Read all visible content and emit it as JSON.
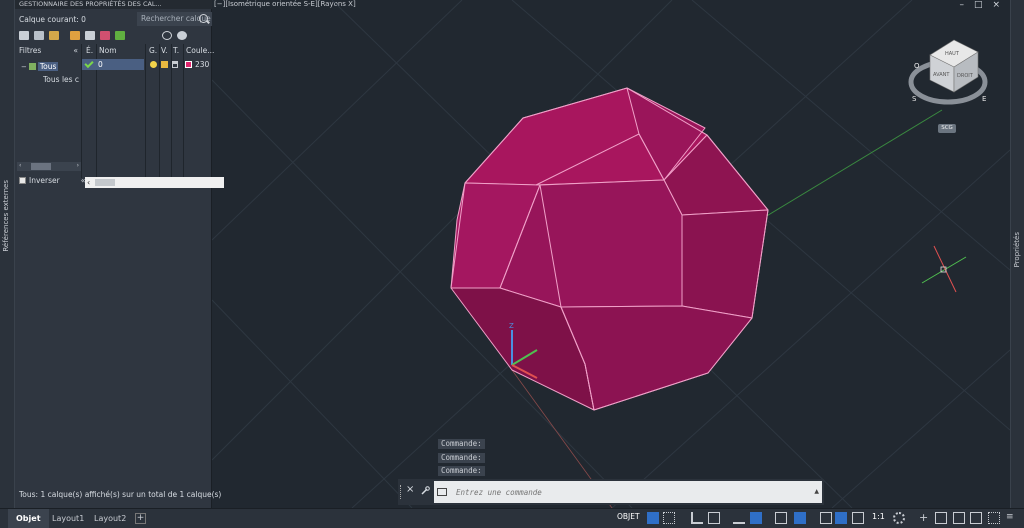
{
  "palette": {
    "title": "GESTIONNAIRE DES PROPRIÉTÉS DES CAL...",
    "current_layer": "Calque courant: 0",
    "search_placeholder": "Rechercher calque",
    "filters_label": "Filtres",
    "collapse_glyph": "«",
    "tree_tous": "Tous",
    "tree_used": "Tous les calques utilisés",
    "invert_label": "Inverser",
    "columns": [
      "É.",
      "Nom",
      "G.",
      "V.",
      "T.",
      "Coule..."
    ],
    "rows": [
      {
        "name": "0",
        "color_value": "230",
        "color": "#e0266e"
      }
    ],
    "status": "Tous: 1 calque(s) affiché(s) sur un total de 1 calque(s)"
  },
  "side_labels": {
    "left": "Références externes",
    "right": "Propriétés"
  },
  "viewport": {
    "label": "[−][Isométrique orientée S-E][Rayons X]",
    "window_controls": [
      "–",
      "□",
      "×"
    ]
  },
  "viewcube": {
    "faces": [
      "HAUT",
      "AVANT",
      "DROIT"
    ],
    "compass": [
      "O",
      "S",
      "E"
    ],
    "ucs_label": "SCG"
  },
  "command": {
    "history": [
      "Commande:",
      "Commande:",
      "Commande:"
    ],
    "placeholder": "Entrez une commande",
    "close_glyph": "×",
    "up_glyph": "▲"
  },
  "statusbar": {
    "tabs": [
      "Objet",
      "Layout1",
      "Layout2"
    ],
    "add_glyph": "+",
    "mode_label": "OBJET",
    "scale_label": "1:1"
  },
  "colors": {
    "face_fill": "#8e1451",
    "face_stroke": "#f0a0c8",
    "axis_x": "#e05050",
    "axis_y": "#50c050",
    "axis_z": "#4a90e0",
    "accent": "#2f6fc7"
  }
}
